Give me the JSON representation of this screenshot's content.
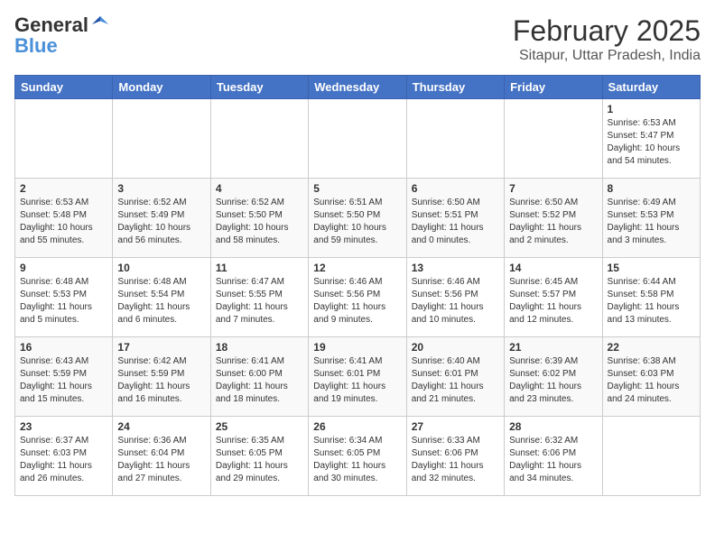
{
  "header": {
    "logo_general": "General",
    "logo_blue": "Blue",
    "month_title": "February 2025",
    "subtitle": "Sitapur, Uttar Pradesh, India"
  },
  "weekdays": [
    "Sunday",
    "Monday",
    "Tuesday",
    "Wednesday",
    "Thursday",
    "Friday",
    "Saturday"
  ],
  "weeks": [
    [
      {
        "day": "",
        "info": ""
      },
      {
        "day": "",
        "info": ""
      },
      {
        "day": "",
        "info": ""
      },
      {
        "day": "",
        "info": ""
      },
      {
        "day": "",
        "info": ""
      },
      {
        "day": "",
        "info": ""
      },
      {
        "day": "1",
        "info": "Sunrise: 6:53 AM\nSunset: 5:47 PM\nDaylight: 10 hours and 54 minutes."
      }
    ],
    [
      {
        "day": "2",
        "info": "Sunrise: 6:53 AM\nSunset: 5:48 PM\nDaylight: 10 hours and 55 minutes."
      },
      {
        "day": "3",
        "info": "Sunrise: 6:52 AM\nSunset: 5:49 PM\nDaylight: 10 hours and 56 minutes."
      },
      {
        "day": "4",
        "info": "Sunrise: 6:52 AM\nSunset: 5:50 PM\nDaylight: 10 hours and 58 minutes."
      },
      {
        "day": "5",
        "info": "Sunrise: 6:51 AM\nSunset: 5:50 PM\nDaylight: 10 hours and 59 minutes."
      },
      {
        "day": "6",
        "info": "Sunrise: 6:50 AM\nSunset: 5:51 PM\nDaylight: 11 hours and 0 minutes."
      },
      {
        "day": "7",
        "info": "Sunrise: 6:50 AM\nSunset: 5:52 PM\nDaylight: 11 hours and 2 minutes."
      },
      {
        "day": "8",
        "info": "Sunrise: 6:49 AM\nSunset: 5:53 PM\nDaylight: 11 hours and 3 minutes."
      }
    ],
    [
      {
        "day": "9",
        "info": "Sunrise: 6:48 AM\nSunset: 5:53 PM\nDaylight: 11 hours and 5 minutes."
      },
      {
        "day": "10",
        "info": "Sunrise: 6:48 AM\nSunset: 5:54 PM\nDaylight: 11 hours and 6 minutes."
      },
      {
        "day": "11",
        "info": "Sunrise: 6:47 AM\nSunset: 5:55 PM\nDaylight: 11 hours and 7 minutes."
      },
      {
        "day": "12",
        "info": "Sunrise: 6:46 AM\nSunset: 5:56 PM\nDaylight: 11 hours and 9 minutes."
      },
      {
        "day": "13",
        "info": "Sunrise: 6:46 AM\nSunset: 5:56 PM\nDaylight: 11 hours and 10 minutes."
      },
      {
        "day": "14",
        "info": "Sunrise: 6:45 AM\nSunset: 5:57 PM\nDaylight: 11 hours and 12 minutes."
      },
      {
        "day": "15",
        "info": "Sunrise: 6:44 AM\nSunset: 5:58 PM\nDaylight: 11 hours and 13 minutes."
      }
    ],
    [
      {
        "day": "16",
        "info": "Sunrise: 6:43 AM\nSunset: 5:59 PM\nDaylight: 11 hours and 15 minutes."
      },
      {
        "day": "17",
        "info": "Sunrise: 6:42 AM\nSunset: 5:59 PM\nDaylight: 11 hours and 16 minutes."
      },
      {
        "day": "18",
        "info": "Sunrise: 6:41 AM\nSunset: 6:00 PM\nDaylight: 11 hours and 18 minutes."
      },
      {
        "day": "19",
        "info": "Sunrise: 6:41 AM\nSunset: 6:01 PM\nDaylight: 11 hours and 19 minutes."
      },
      {
        "day": "20",
        "info": "Sunrise: 6:40 AM\nSunset: 6:01 PM\nDaylight: 11 hours and 21 minutes."
      },
      {
        "day": "21",
        "info": "Sunrise: 6:39 AM\nSunset: 6:02 PM\nDaylight: 11 hours and 23 minutes."
      },
      {
        "day": "22",
        "info": "Sunrise: 6:38 AM\nSunset: 6:03 PM\nDaylight: 11 hours and 24 minutes."
      }
    ],
    [
      {
        "day": "23",
        "info": "Sunrise: 6:37 AM\nSunset: 6:03 PM\nDaylight: 11 hours and 26 minutes."
      },
      {
        "day": "24",
        "info": "Sunrise: 6:36 AM\nSunset: 6:04 PM\nDaylight: 11 hours and 27 minutes."
      },
      {
        "day": "25",
        "info": "Sunrise: 6:35 AM\nSunset: 6:05 PM\nDaylight: 11 hours and 29 minutes."
      },
      {
        "day": "26",
        "info": "Sunrise: 6:34 AM\nSunset: 6:05 PM\nDaylight: 11 hours and 30 minutes."
      },
      {
        "day": "27",
        "info": "Sunrise: 6:33 AM\nSunset: 6:06 PM\nDaylight: 11 hours and 32 minutes."
      },
      {
        "day": "28",
        "info": "Sunrise: 6:32 AM\nSunset: 6:06 PM\nDaylight: 11 hours and 34 minutes."
      },
      {
        "day": "",
        "info": ""
      }
    ]
  ]
}
